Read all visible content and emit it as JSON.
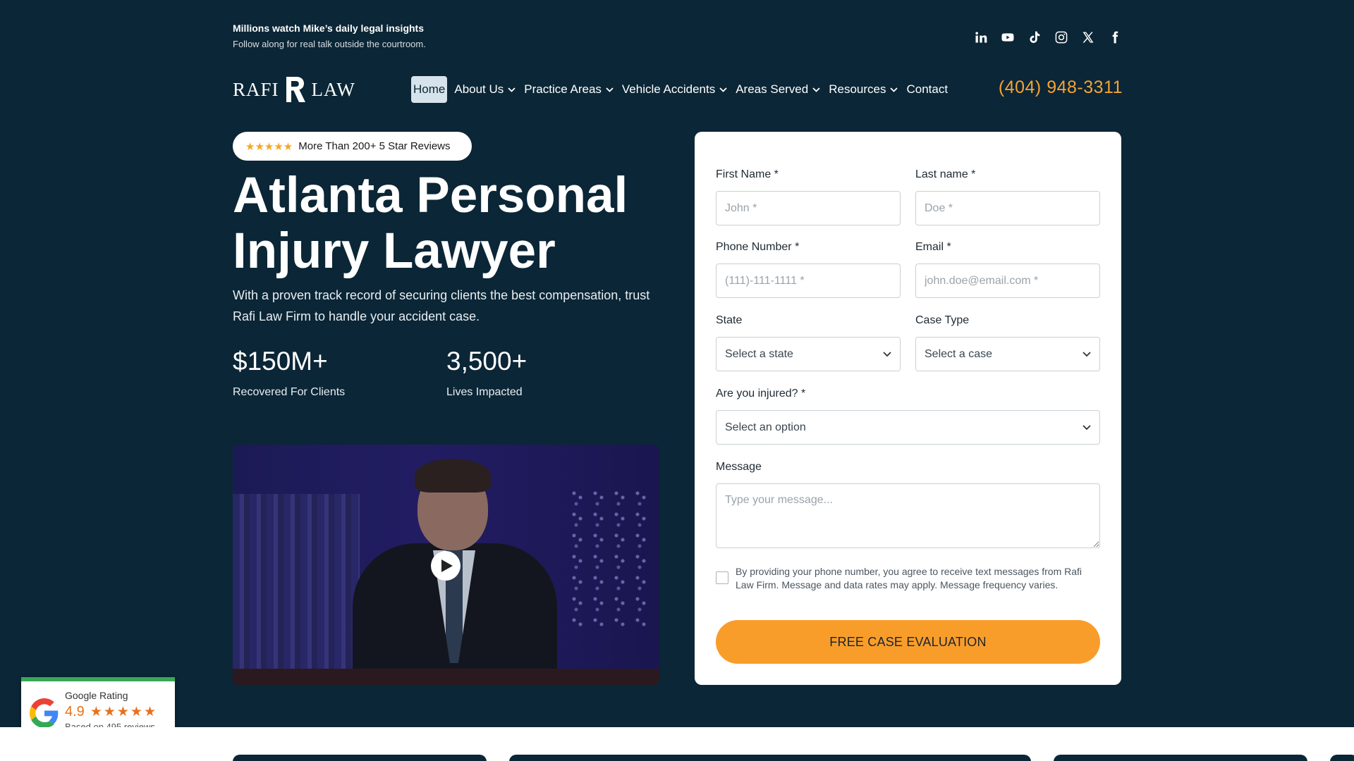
{
  "topbar": {
    "headline": "Millions watch Mike’s daily legal insights",
    "subline": "Follow along for real talk outside the courtroom.",
    "socials": [
      "linkedin-icon",
      "youtube-icon",
      "tiktok-icon",
      "instagram-icon",
      "x-icon",
      "facebook-icon"
    ]
  },
  "nav": {
    "logo_left": "RAFI",
    "logo_right": "LAW",
    "items": [
      {
        "label": "Home",
        "dropdown": false,
        "active": true
      },
      {
        "label": "About Us",
        "dropdown": true
      },
      {
        "label": "Practice Areas",
        "dropdown": true
      },
      {
        "label": "Vehicle Accidents",
        "dropdown": true
      },
      {
        "label": "Areas Served",
        "dropdown": true
      },
      {
        "label": "Resources",
        "dropdown": true
      },
      {
        "label": "Contact",
        "dropdown": false
      }
    ],
    "phone": "(404) 948-3311"
  },
  "hero": {
    "reviews_pill": "More Than 200+ 5 Star Reviews",
    "stars": "★★★★★",
    "title_line1": "Atlanta Personal",
    "title_line2": "Injury Lawyer",
    "description": "With a proven track record of securing clients the best compensation, trust Rafi Law Firm to handle your accident case.",
    "stats": [
      {
        "value": "$150M+",
        "label": "Recovered For Clients"
      },
      {
        "value": "3,500+",
        "label": "Lives Impacted"
      }
    ]
  },
  "form": {
    "first_name_label": "First Name *",
    "first_name_placeholder": "John *",
    "last_name_label": "Last name *",
    "last_name_placeholder": "Doe *",
    "phone_label": "Phone Number *",
    "phone_placeholder": "(111)-111-1111 *",
    "email_label": "Email *",
    "email_placeholder": "john.doe@email.com *",
    "state_label": "State",
    "state_value": "Select a state",
    "case_label": "Case Type",
    "case_value": "Select a case",
    "injured_label": "Are you injured? *",
    "injured_value": "Select an option",
    "message_label": "Message",
    "message_placeholder": "Type your message...",
    "consent": "By providing your phone number, you agree to receive text messages from Rafi Law Firm. Message and data rates may apply. Message frequency varies.",
    "submit": "FREE CASE EVALUATION"
  },
  "google": {
    "title": "Google Rating",
    "score": "4.9",
    "stars": "★★★★★",
    "reviews": "Based on 495 reviews"
  },
  "colors": {
    "background": "#0b2636",
    "accent": "#f99d2a",
    "phone": "#f7a234",
    "google_green": "#3aa757"
  }
}
